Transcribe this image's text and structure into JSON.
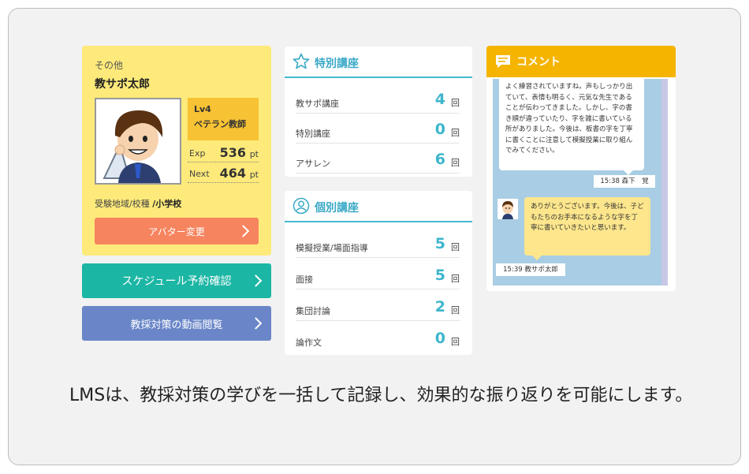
{
  "profile": {
    "category": "その他",
    "name": "教サポ太郎",
    "level": "Lv4",
    "rank": "ベテラン教師",
    "exp_label": "Exp",
    "exp_value": "536",
    "next_label": "Next",
    "next_value": "464",
    "unit": "pt",
    "area_label": "受験地域/校種",
    "area_value": "/小学校",
    "avatar_button": "アバター変更"
  },
  "buttons": {
    "schedule": "スケジュール予約確認",
    "video": "教採対策の動画閲覧"
  },
  "special": {
    "title": "特別講座",
    "rows": [
      {
        "name": "教サポ講座",
        "count": "4",
        "unit": "回"
      },
      {
        "name": "特別講座",
        "count": "0",
        "unit": "回"
      },
      {
        "name": "アサレン",
        "count": "6",
        "unit": "回"
      }
    ]
  },
  "individual": {
    "title": "個別講座",
    "rows": [
      {
        "name": "模擬授業/場面指導",
        "count": "5",
        "unit": "回"
      },
      {
        "name": "面接",
        "count": "5",
        "unit": "回"
      },
      {
        "name": "集団討論",
        "count": "2",
        "unit": "回"
      },
      {
        "name": "論作文",
        "count": "0",
        "unit": "回"
      }
    ]
  },
  "comment": {
    "title": "コメント",
    "msg1": "よく練習されていますね。声もしっかり出ていて、表情も明るく、元気な先生であることが伝わってきました。しかし、字の書き順が違っていたり、字を雑に書いている所がありました。今後は、板書の字を丁寧に書くことに注意して模擬授業に取り組んでみてください。",
    "time1": "15:38 森下　覚",
    "msg2": "ありがとうございます。今後は、子どもたちのお手本になるような字を丁寧に書いていきたいと思います。",
    "time2": "15:39 教サポ太郎"
  },
  "caption": "LMSは、教採対策の学びを一括して記録し、効果的な振り返りを可能にします。",
  "colors": {
    "profile_bg": "#fdea7a",
    "level_bg": "#f7c233",
    "avatar_button": "#f6845f",
    "schedule_button": "#1cb6a4",
    "video_button": "#6a86c8",
    "accent_blue": "#3eb6cc",
    "comment_header": "#f5b400",
    "chat_bg": "#a9cde4"
  }
}
